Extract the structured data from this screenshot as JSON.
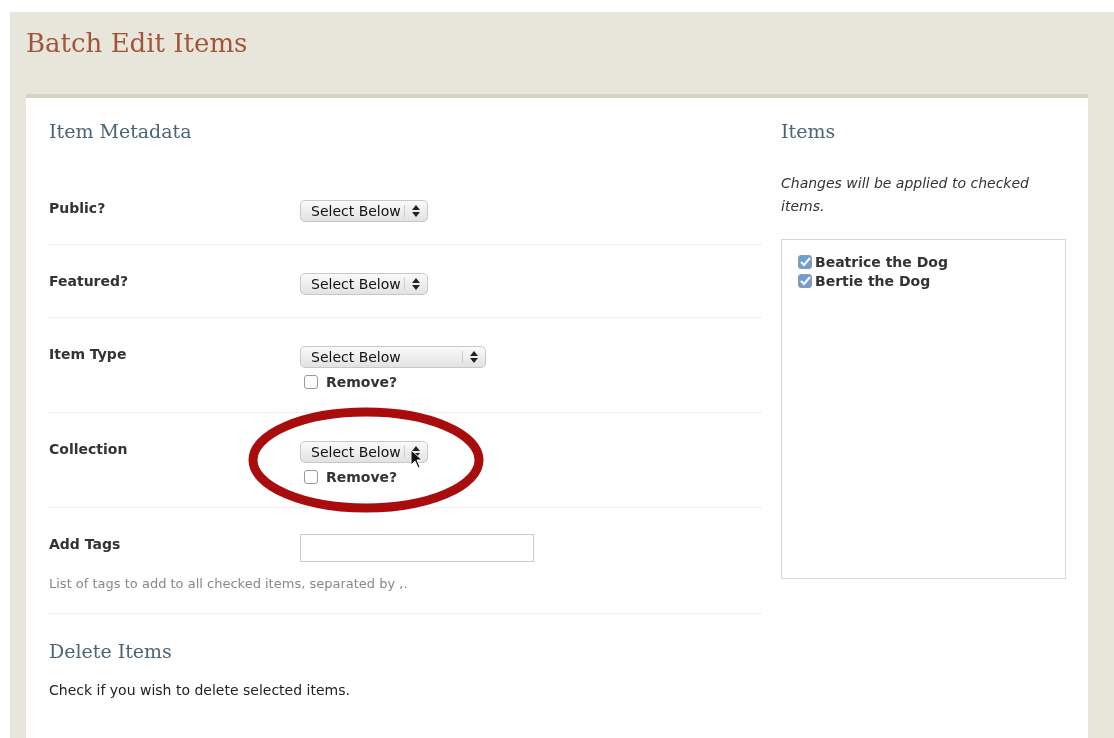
{
  "page": {
    "title": "Batch Edit Items"
  },
  "metadata": {
    "heading": "Item Metadata",
    "fields": [
      {
        "kind": "select",
        "label": "Public?",
        "value": "Select Below"
      },
      {
        "kind": "select",
        "label": "Featured?",
        "value": "Select Below"
      },
      {
        "kind": "select",
        "label": "Item Type",
        "value": "Select Below",
        "wide": true,
        "remove": {
          "label": "Remove?",
          "checked": false
        }
      },
      {
        "kind": "select",
        "label": "Collection",
        "value": "Select Below",
        "remove": {
          "label": "Remove?",
          "checked": false
        },
        "highlighted": true,
        "cursor": true
      },
      {
        "kind": "text",
        "label": "Add Tags",
        "hint": "List of tags to add to all checked items, separated by ,."
      }
    ]
  },
  "delete": {
    "heading": "Delete Items",
    "text": "Check if you wish to delete selected items."
  },
  "items": {
    "heading": "Items",
    "note": "Changes will be applied to checked items.",
    "list": [
      {
        "label": "Beatrice the Dog",
        "checked": true
      },
      {
        "label": "Bertie the Dog",
        "checked": true
      }
    ]
  }
}
